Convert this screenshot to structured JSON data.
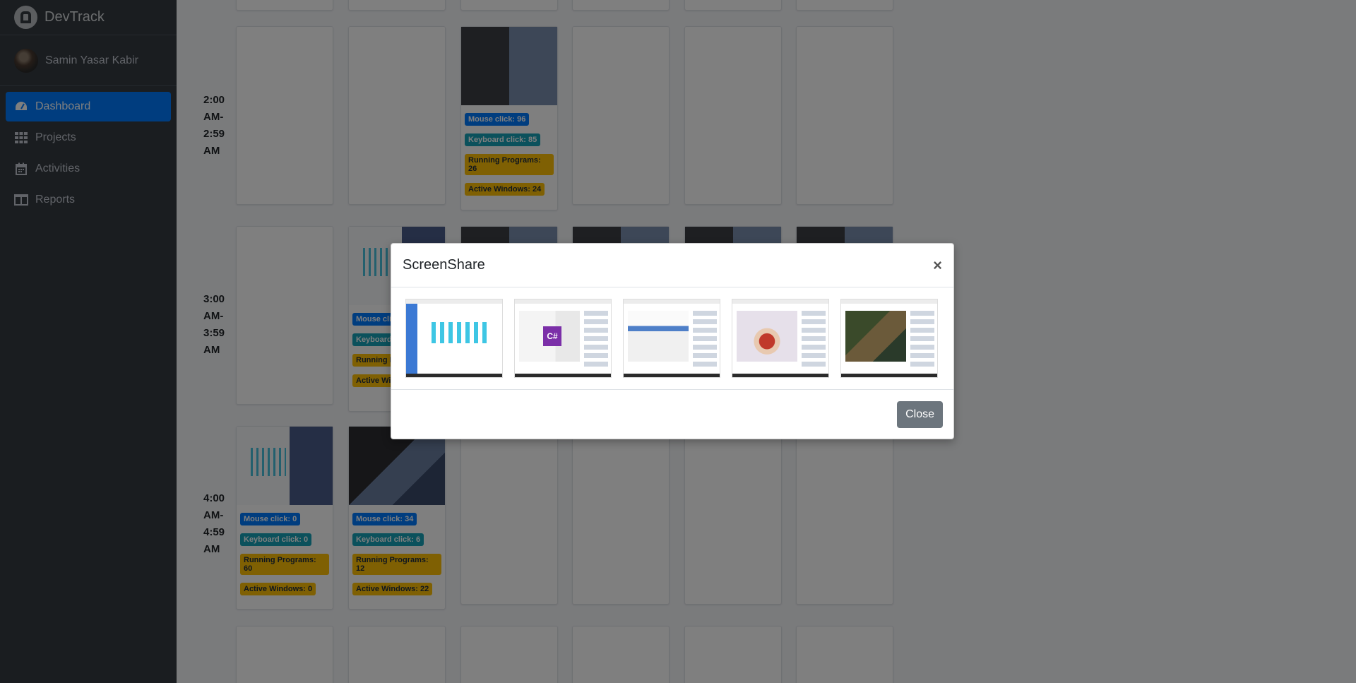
{
  "app": {
    "brand": "DevTrack"
  },
  "user": {
    "name": "Samin Yasar Kabir"
  },
  "nav": [
    {
      "label": "Dashboard",
      "icon": "dashboard-icon",
      "active": true
    },
    {
      "label": "Projects",
      "icon": "grid-icon"
    },
    {
      "label": "Activities",
      "icon": "calendar-icon"
    },
    {
      "label": "Reports",
      "icon": "columns-icon"
    }
  ],
  "timeline": {
    "rows": [
      {
        "label": "2:00 AM-2:59 AM"
      },
      {
        "label": "3:00 AM-3:59 AM"
      },
      {
        "label": "4:00 AM-4:59 AM"
      }
    ],
    "cells": {
      "r2c3": {
        "mouse": "Mouse click: 96",
        "keyboard": "Keyboard click: 85",
        "programs": "Running Programs: 26",
        "windows": "Active Windows: 24"
      },
      "r3c2": {
        "mouse": "Mouse clic",
        "keyboard": "Keyboard",
        "programs": "Running P",
        "windows": "Active Win"
      },
      "r4c1": {
        "mouse": "Mouse click: 0",
        "keyboard": "Keyboard click: 0",
        "programs": "Running Programs: 60",
        "windows": "Active Windows: 0"
      },
      "r4c2": {
        "mouse": "Mouse click: 34",
        "keyboard": "Keyboard click: 6",
        "programs": "Running Programs: 12",
        "windows": "Active Windows: 22"
      }
    }
  },
  "modal": {
    "title": "ScreenShare",
    "close_symbol": "×",
    "close_button": "Close",
    "thumb_text": "C#"
  }
}
